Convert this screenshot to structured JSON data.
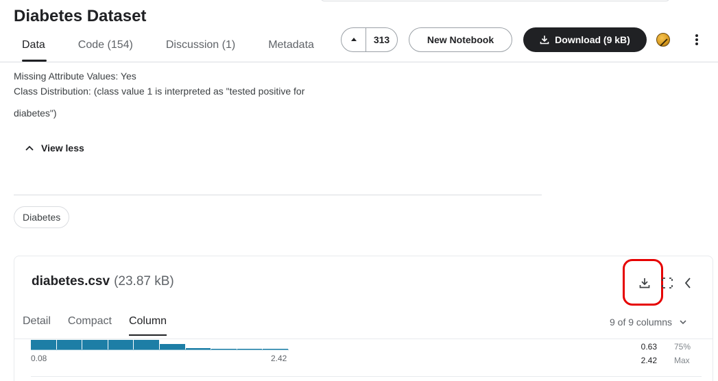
{
  "page": {
    "title": "Diabetes Dataset",
    "tabs": [
      {
        "label": "Data"
      },
      {
        "label": "Code (154)"
      },
      {
        "label": "Discussion (1)"
      },
      {
        "label": "Metadata"
      }
    ]
  },
  "actions": {
    "vote_count": "313",
    "new_notebook": "New Notebook",
    "download": "Download (9 kB)"
  },
  "description": {
    "line1": "Missing Attribute Values: Yes",
    "line2": "Class Distribution: (class value 1 is interpreted as \"tested positive for",
    "line3": "diabetes\")",
    "view_less": "View less"
  },
  "tags": [
    {
      "label": "Diabetes"
    }
  ],
  "file": {
    "name": "diabetes.csv",
    "size": "(23.87 kB)",
    "subtabs": [
      {
        "label": "Detail"
      },
      {
        "label": "Compact"
      },
      {
        "label": "Column"
      }
    ],
    "columns_selector": "9 of 9 columns"
  },
  "column_preview": {
    "histogram_fractions": [
      1.0,
      1.0,
      1.0,
      1.0,
      1.0,
      0.55,
      0.12,
      0.1,
      0.08,
      0.08
    ],
    "min_label": "0.08",
    "max_label": "2.42",
    "stats": [
      {
        "value": "0.63",
        "label": "75%"
      },
      {
        "value": "2.42",
        "label": "Max"
      }
    ]
  },
  "colors": {
    "accent_dark": "#202124",
    "histogram": "#1d7ea6",
    "highlight": "#e60000"
  }
}
